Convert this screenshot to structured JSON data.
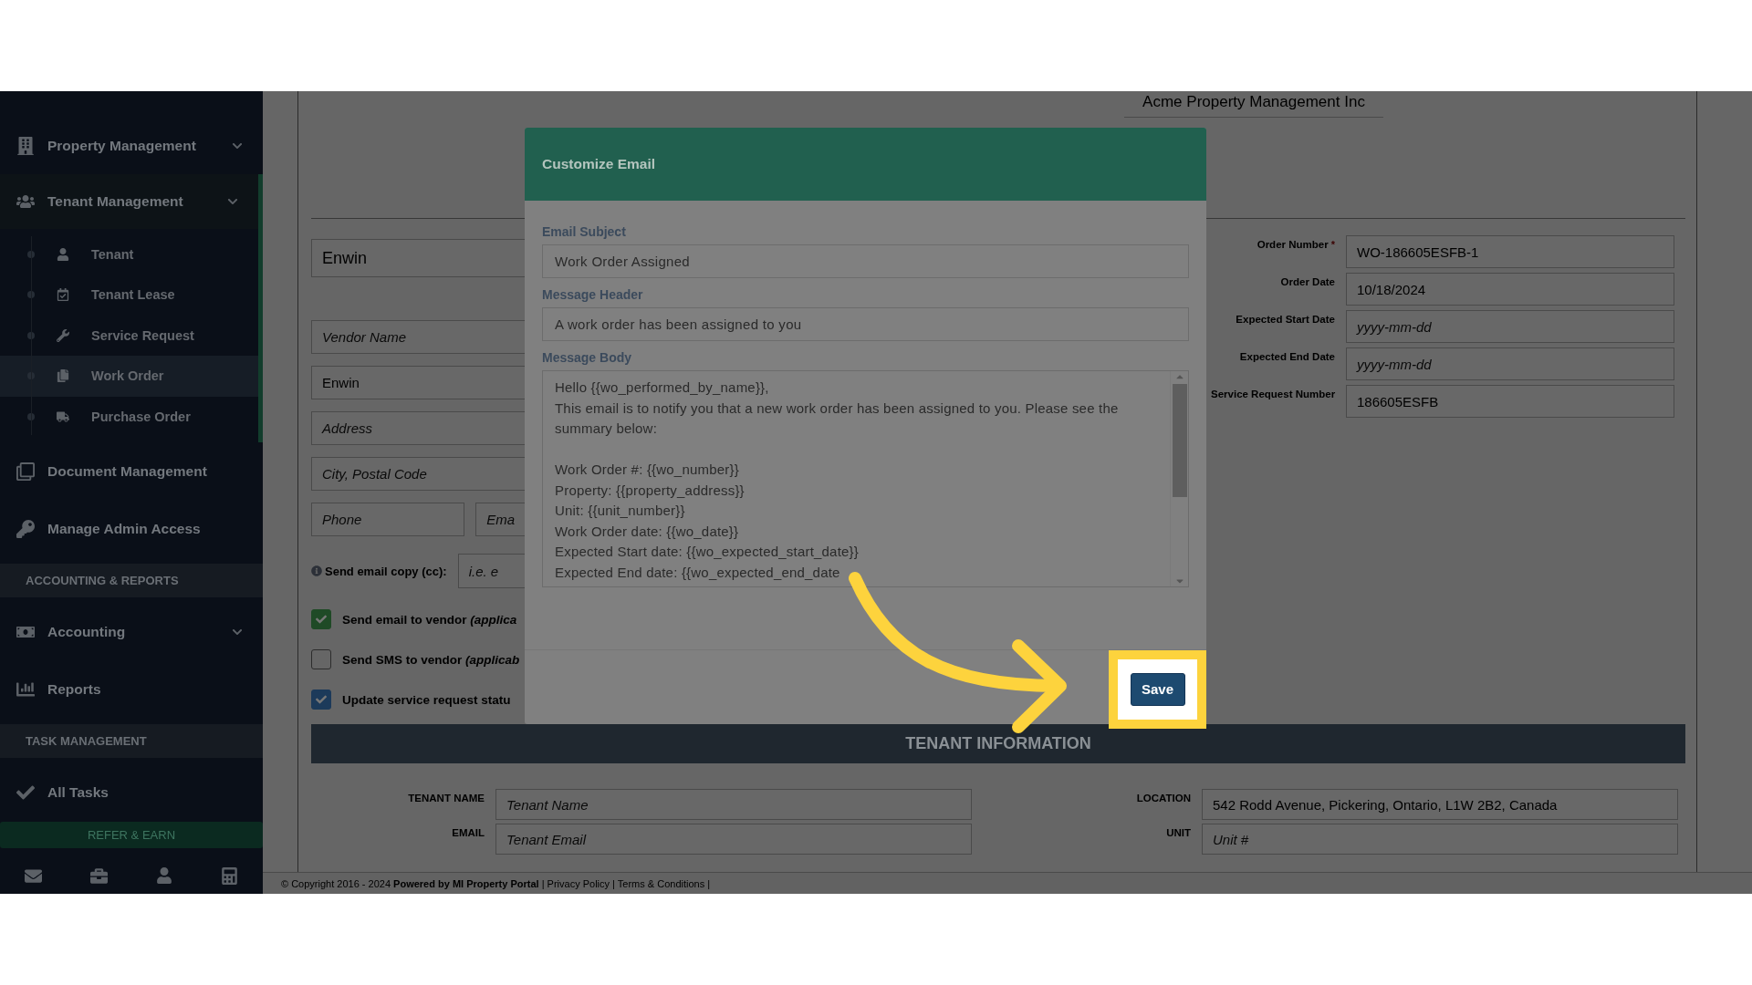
{
  "page_heading": "Acme Property Management Inc",
  "sidebar": {
    "items": [
      {
        "kind": "menu",
        "label": "Property Management",
        "dropdown": true,
        "selected": false
      },
      {
        "kind": "menu",
        "label": "Tenant Management",
        "dropdown": true,
        "expanded": true,
        "selected": true,
        "children": [
          {
            "label": "Tenant",
            "selected": false
          },
          {
            "label": "Tenant Lease",
            "selected": false
          },
          {
            "label": "Service Request",
            "selected": false
          },
          {
            "label": "Work Order",
            "selected": true
          },
          {
            "label": "Purchase Order",
            "selected": false
          }
        ]
      },
      {
        "kind": "menu",
        "label": "Document Management",
        "dropdown": false,
        "selected": false
      },
      {
        "kind": "menu",
        "label": "Manage Admin Access",
        "dropdown": false,
        "selected": false
      },
      {
        "kind": "section",
        "label": "ACCOUNTING & REPORTS"
      },
      {
        "kind": "menu",
        "label": "Accounting",
        "dropdown": true,
        "selected": false
      },
      {
        "kind": "menu",
        "label": "Reports",
        "dropdown": false,
        "selected": false
      },
      {
        "kind": "section",
        "label": "TASK MANAGEMENT"
      },
      {
        "kind": "menu",
        "label": "All Tasks",
        "dropdown": false,
        "selected": false
      }
    ],
    "refer_button": "REFER & EARN"
  },
  "vendor": {
    "company": "Enwin",
    "fields": [
      {
        "placeholder": "Vendor Name"
      },
      {
        "value": "Enwin"
      },
      {
        "placeholder": "Address"
      },
      {
        "placeholder": "City, Postal Code"
      }
    ],
    "phone": {
      "placeholder": "Phone"
    },
    "email": {
      "placeholder": "Ema"
    },
    "cc": {
      "label": "Send email copy (cc):",
      "placeholder": "i.e. e"
    },
    "options": [
      {
        "label": "Send email to vendor *(applica*",
        "checked": true,
        "color": "#1f4a26"
      },
      {
        "label": "Send SMS to vendor *(applicab*",
        "checked": false
      },
      {
        "label": "Update service request statu",
        "checked": true,
        "color": "#1c3a5a"
      }
    ]
  },
  "order": {
    "fields": [
      {
        "label": "Order Number",
        "required_mark": "*",
        "value": "WO-186605ESFB-1"
      },
      {
        "label": "Order Date",
        "value": "10/18/2024"
      },
      {
        "label": "Expected Start Date",
        "placeholder": "yyyy-mm-dd"
      },
      {
        "label": "Expected End Date",
        "placeholder": "yyyy-mm-dd"
      },
      {
        "label": "Service Request Number",
        "value": "186605ESFB"
      }
    ]
  },
  "tenant_info": {
    "title": "TENANT INFORMATION",
    "fields": [
      {
        "label": "TENANT NAME",
        "placeholder": "Tenant Name"
      },
      {
        "label": "LOCATION",
        "value": "542 Rodd Avenue, Pickering, Ontario, L1W 2B2, Canada"
      },
      {
        "label": "EMAIL",
        "placeholder": "Tenant Email"
      },
      {
        "label": "UNIT",
        "placeholder": "Unit #"
      }
    ]
  },
  "footer": "© Copyright 2016 - 2024 **Powered by MI Property Portal** | Privacy Policy | Terms & Conditions |",
  "modal": {
    "title": "Customize Email",
    "subject": {
      "label": "Email Subject",
      "value": "Work Order Assigned"
    },
    "header": {
      "label": "Message Header",
      "value": "A work order has been assigned to you"
    },
    "body": {
      "label": "Message Body",
      "value": "Hello {{wo_performed_by_name}},\nThis email is to notify you that a new work order has been assigned to you. Please see the summary below:\n\nWork Order #: {{wo_number}}\nProperty: {{property_address}}\nUnit: {{unit_number}}\nWork Order date: {{wo_date}}\nExpected Start date: {{wo_expected_start_date}}\nExpected End date: {{wo_expected_end_date"
    },
    "save_button": "Save"
  }
}
